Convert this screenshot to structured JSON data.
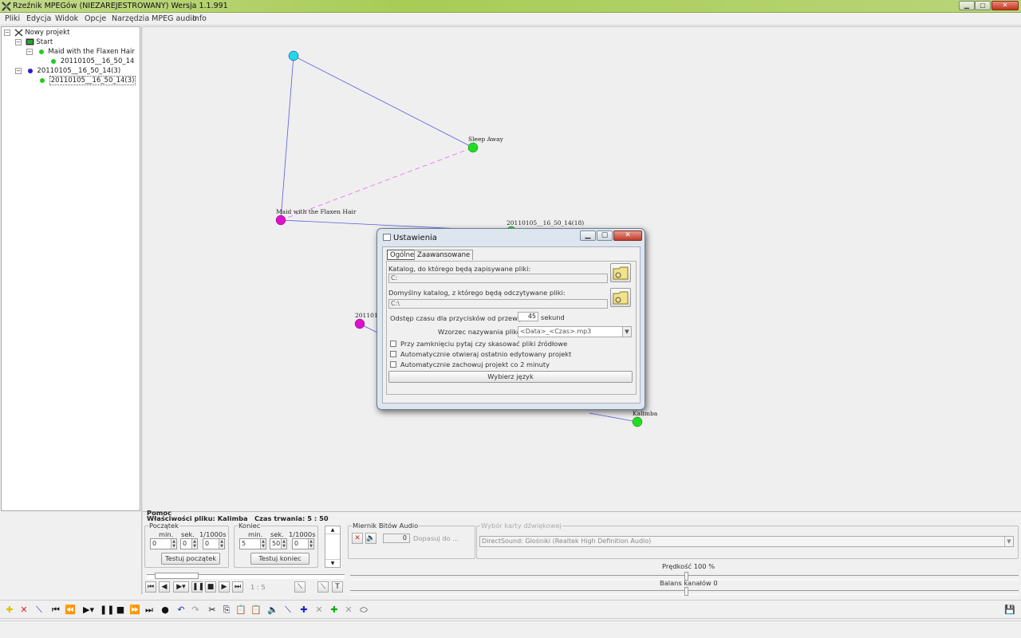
{
  "window": {
    "title": "Rzeźnik MPEGów  (NIEZAREJESTROWANY)  Wersja 1.1.991",
    "controls": {
      "minimize": "▁",
      "maximize": "▢",
      "close": "✕"
    }
  },
  "menu": [
    "Pliki",
    "Edycja",
    "Widok",
    "Opcje",
    "Narzędzia MPEG audio",
    "Info"
  ],
  "tree": {
    "root": "Nowy projekt",
    "start": "Start",
    "maid": "Maid with the Flaxen Hair",
    "maid_child": "20110105__16_50_14",
    "group2": "20110105__16_50_14(3)",
    "group2_child": "20110105__16_50_14(3)"
  },
  "graph": {
    "labels": {
      "sleep": "Sleep Away",
      "maid": "Maid with the Flaxen Hair",
      "n18": "20110105__16_50_14(18)",
      "n2011": "2011010",
      "kalimba": "Kalimba"
    },
    "colors": {
      "cyan": "#22d8e8",
      "green": "#22dd22",
      "magenta": "#dd11cc",
      "edge": "#5a5ae0",
      "dash": "#ee66ee"
    }
  },
  "dialog": {
    "title": "Ustawienia",
    "tabs": [
      "Ogólne",
      "Zaawansowane"
    ],
    "save_dir_label": "Katalog, do którego będą zapisywane pliki:",
    "save_dir_value": "C:",
    "read_dir_label": "Domyślny katalog, z którego będą odczytywane pliki:",
    "read_dir_value": "C:\\",
    "interval_label": "Odstęp czasu dla przycisków od przewijania",
    "interval_value": "45",
    "interval_unit": "sekund",
    "pattern_label": "Wzorzec nazywania plików",
    "pattern_value": "<Data>_<Czas>.mp3",
    "checkboxes": [
      "Przy zamknięciu pytaj czy skasować pliki źródłowe",
      "Automatycznie otwieraj ostatnio edytowany projekt",
      "Automatycznie zachowuj projekt co 2 minuty"
    ],
    "language_button": "Wybierz język"
  },
  "panel": {
    "help": "Pomoc",
    "properties": "Właściwości pliku: Kalimba",
    "duration": "Czas trwania: 5 : 50",
    "start_group": "Początek",
    "end_group": "Koniec",
    "col_min": "min.",
    "col_sek": "sek.",
    "col_ms": "1/1000s",
    "start_values": [
      "0",
      "0",
      "0"
    ],
    "end_values": [
      "5",
      "50",
      "0"
    ],
    "test_start": "Testuj początek",
    "test_end": "Testuj koniec",
    "position_text": "1 : 5",
    "meter_group": "Miernik Bitów Audio",
    "meter_value": "0",
    "adjust_label": "Dopasuj do ...",
    "soundcard_group": "Wybór karty dźwiękowej",
    "soundcard_value": "DirectSound: Głośniki (Realtek High Definition Audio)",
    "speed_label": "Prędkość 100 %",
    "balance_label": "Balans kanałów 0"
  }
}
